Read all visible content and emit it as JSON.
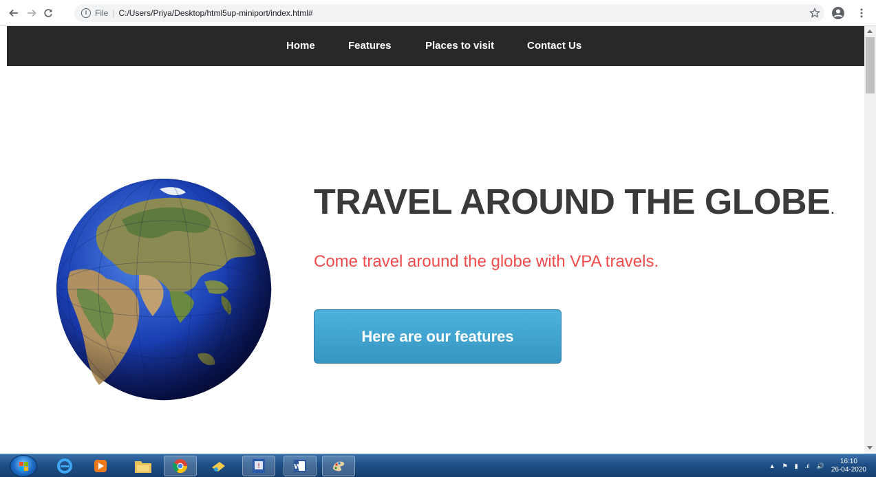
{
  "browser": {
    "address_scheme": "File",
    "address_url": "C:/Users/Priya/Desktop/html5up-miniport/index.html#"
  },
  "nav": {
    "items": [
      {
        "label": "Home"
      },
      {
        "label": "Features"
      },
      {
        "label": "Places to visit"
      },
      {
        "label": "Contact Us"
      }
    ]
  },
  "hero": {
    "title": "TRAVEL AROUND THE GLOBE",
    "title_suffix": ".",
    "subtitle": "Come travel around the globe with VPA travels.",
    "button_label": "Here are our features"
  },
  "taskbar": {
    "time": "16:10",
    "date": "26-04-2020",
    "apps": [
      "internet-explorer-icon",
      "media-player-icon",
      "file-explorer-icon",
      "chrome-icon",
      "paint-palette-icon",
      "microsoft-word-icon",
      "paint-icon"
    ]
  },
  "colors": {
    "nav_bg": "#282828",
    "title": "#3a3a3a",
    "subtitle": "#f34b4b",
    "button": "#3ea0cd"
  }
}
